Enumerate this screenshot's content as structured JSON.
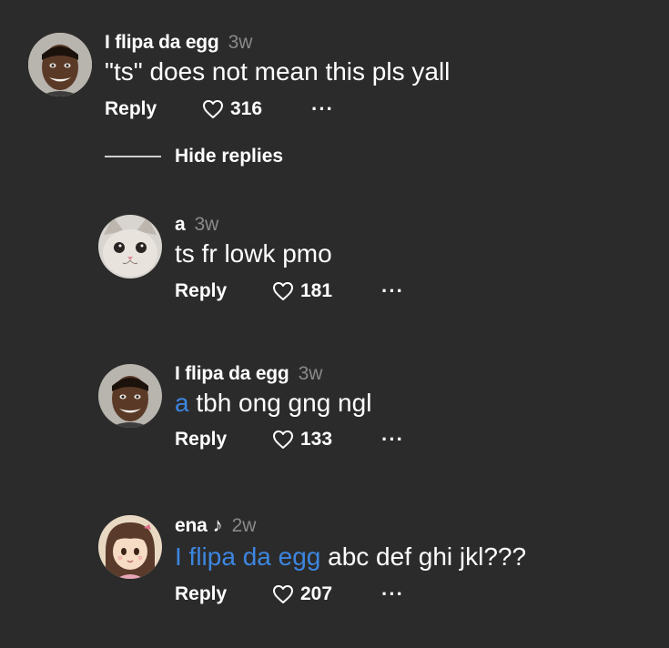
{
  "comments": [
    {
      "author": "I flipa da egg",
      "author_note": "",
      "time": "3w",
      "mention": "",
      "text": "\"ts\" does not mean this pls yall",
      "reply_label": "Reply",
      "likes": "316",
      "more_label": "···",
      "avatar_icon": "avatar-man-icon"
    },
    {
      "author": "a",
      "author_note": "",
      "time": "3w",
      "mention": "",
      "text": "ts fr lowk pmo",
      "reply_label": "Reply",
      "likes": "181",
      "more_label": "···",
      "avatar_icon": "avatar-cat-icon"
    },
    {
      "author": "I flipa da egg",
      "author_note": "",
      "time": "3w",
      "mention": "a",
      "text": " tbh ong gng ngl",
      "reply_label": "Reply",
      "likes": "133",
      "more_label": "···",
      "avatar_icon": "avatar-man-icon"
    },
    {
      "author": "ena",
      "author_note": "♪",
      "time": "2w",
      "mention": "I flipa da egg",
      "text": " abc def ghi jkl???",
      "reply_label": "Reply",
      "likes": "207",
      "more_label": "···",
      "avatar_icon": "avatar-anime-girl-icon"
    }
  ],
  "thread": {
    "hide_replies_label": "Hide replies"
  },
  "colors": {
    "background": "#2b2b2b",
    "mention": "#3d86e0",
    "muted": "#8a8a8a",
    "text": "#ffffff"
  }
}
